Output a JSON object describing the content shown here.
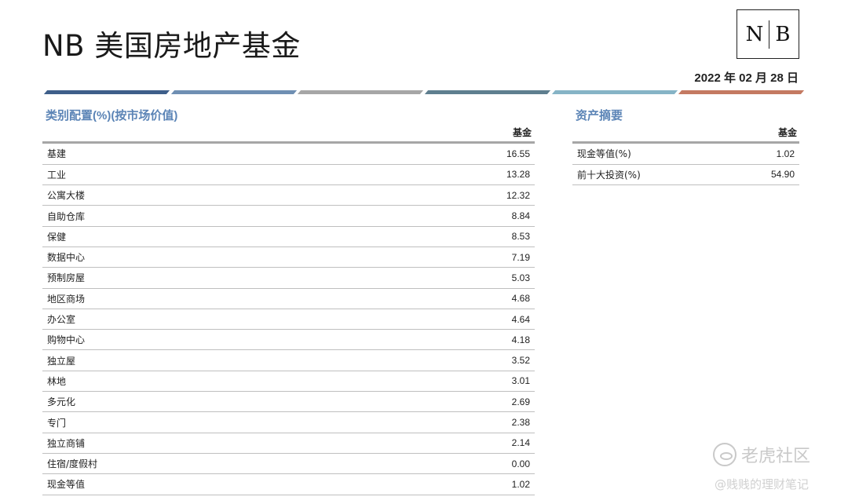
{
  "header": {
    "title": "NB 美国房地产基金",
    "logo_left": "N",
    "logo_right": "B",
    "date": "2022 年 02 月 28 日"
  },
  "stripe_colors": [
    "#3e5f8a",
    "#6f8fb3",
    "#a6a6a6",
    "#5f7f8f",
    "#86b4c6",
    "#c47a62"
  ],
  "allocation": {
    "title": "类别配置(%)(按市场价值)",
    "column_header": "基金",
    "rows": [
      {
        "label": "基建",
        "value": "16.55"
      },
      {
        "label": "工业",
        "value": "13.28"
      },
      {
        "label": "公寓大楼",
        "value": "12.32"
      },
      {
        "label": "自助仓库",
        "value": "8.84"
      },
      {
        "label": "保健",
        "value": "8.53"
      },
      {
        "label": "数据中心",
        "value": "7.19"
      },
      {
        "label": "预制房屋",
        "value": "5.03"
      },
      {
        "label": "地区商场",
        "value": "4.68"
      },
      {
        "label": "办公室",
        "value": "4.64"
      },
      {
        "label": "购物中心",
        "value": "4.18"
      },
      {
        "label": "独立屋",
        "value": "3.52"
      },
      {
        "label": "林地",
        "value": "3.01"
      },
      {
        "label": "多元化",
        "value": "2.69"
      },
      {
        "label": "专门",
        "value": "2.38"
      },
      {
        "label": "独立商铺",
        "value": "2.14"
      },
      {
        "label": "住宿/度假村",
        "value": "0.00"
      },
      {
        "label": "现金等值",
        "value": "1.02"
      }
    ]
  },
  "summary": {
    "title": "资产摘要",
    "column_header": "基金",
    "rows": [
      {
        "label": "现金等值(%)",
        "value": "1.02"
      },
      {
        "label": "前十大投资(%)",
        "value": "54.90"
      }
    ]
  },
  "watermark": {
    "brand": "老虎社区",
    "author": "@贱贱的理财笔记"
  }
}
